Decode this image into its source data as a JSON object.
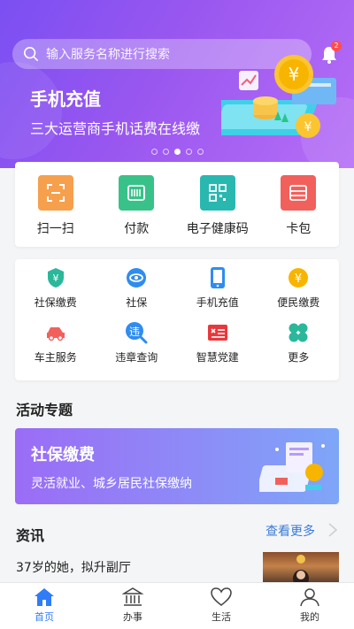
{
  "header": {
    "search_placeholder": "输入服务名称进行搜索",
    "notification_count": "2"
  },
  "hero": {
    "title": "手机充值",
    "subtitle": "三大运营商手机话费在线缴",
    "slide_count": 5,
    "active_slide": 3
  },
  "quick_actions": [
    {
      "label": "扫一扫",
      "icon": "scan-icon",
      "color": "#f6a04d"
    },
    {
      "label": "付款",
      "icon": "barcode-icon",
      "color": "#39c18a"
    },
    {
      "label": "电子健康码",
      "icon": "qrcode-icon",
      "color": "#29b8b0"
    },
    {
      "label": "卡包",
      "icon": "card-wallet-icon",
      "color": "#f2605c"
    }
  ],
  "services": [
    {
      "label": "社保缴费",
      "icon": "social-security-pay-icon"
    },
    {
      "label": "社保",
      "icon": "social-security-icon"
    },
    {
      "label": "手机充值",
      "icon": "phone-recharge-icon"
    },
    {
      "label": "便民缴费",
      "icon": "utility-pay-icon"
    },
    {
      "label": "车主服务",
      "icon": "car-icon"
    },
    {
      "label": "违章查询",
      "icon": "violation-query-icon"
    },
    {
      "label": "智慧党建",
      "icon": "party-building-icon"
    },
    {
      "label": "更多",
      "icon": "more-icon"
    }
  ],
  "activity": {
    "section_title": "活动专题",
    "banner_title": "社保缴费",
    "banner_subtitle": "灵活就业、城乡居民社保缴纳"
  },
  "news": {
    "section_title": "资讯",
    "more_label": "查看更多",
    "items": [
      {
        "title": "37岁的她，拟升副厅"
      }
    ]
  },
  "tabs": [
    {
      "label": "首页",
      "icon": "home-icon",
      "active": true
    },
    {
      "label": "办事",
      "icon": "government-building-icon",
      "active": false
    },
    {
      "label": "生活",
      "icon": "heart-icon",
      "active": false
    },
    {
      "label": "我的",
      "icon": "user-icon",
      "active": false
    }
  ]
}
